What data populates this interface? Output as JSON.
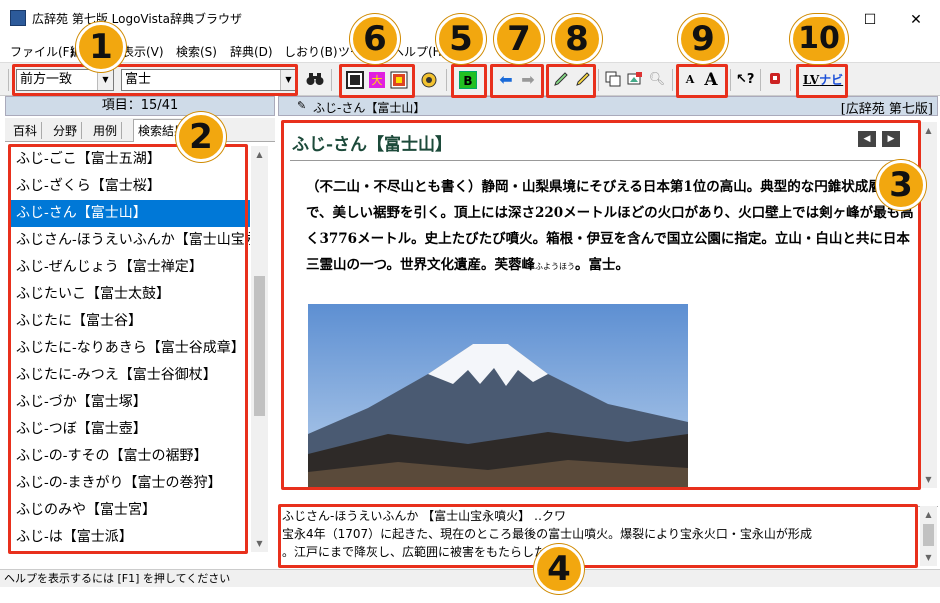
{
  "window": {
    "title": "広辞苑 第七版 LogoVista辞典ブラウザ",
    "minimize": "—",
    "maximize": "☐",
    "close": "✕"
  },
  "menu": [
    {
      "label": "ファイル(F)"
    },
    {
      "label": "編集(E)"
    },
    {
      "label": "表示(V)"
    },
    {
      "label": "検索(S)"
    },
    {
      "label": "辞典(D)"
    },
    {
      "label": "しおり(B)"
    },
    {
      "label": "ツール(T)"
    },
    {
      "label": "ヘルプ(H)"
    }
  ],
  "toolbar": {
    "search_mode": "前方一致",
    "query": "富士",
    "search_icon": "binoculars-icon",
    "highlight_b": "B",
    "font_small": "A",
    "font_large": "A",
    "lv_nav": "ナビ",
    "lv_prefix": "LV"
  },
  "left": {
    "count_label": "項目：15/41",
    "tabs": [
      "百科",
      "分野",
      "用例",
      "検索結果"
    ],
    "items": [
      "ふじ‐ごこ【富士五湖】",
      "ふじ‐ざくら【富士桜】",
      "ふじ‐さん【富士山】",
      "ふじさん‐ほうえいふんか【富士山宝永噴火】",
      "ふじ‐ぜんじょう【富士禅定】",
      "ふじたいこ【富士太鼓】",
      "ふじたに【富士谷】",
      "ふじたに‐なりあきら【富士谷成章】",
      "ふじたに‐みつえ【富士谷御杖】",
      "ふじ‐づか【富士塚】",
      "ふじ‐つぼ【富士壺】",
      "ふじ‐の‐すその【富士の裾野】",
      "ふじ‐の‐まきがり【富士の巻狩】",
      "ふじのみや【富士宮】",
      "ふじ‐は【富士派】"
    ],
    "selected_index": 2
  },
  "path_bar": {
    "entry": "ふじ-さん【富士山】",
    "dictionary": "[広辞苑 第七版]"
  },
  "entry": {
    "headword": "ふじ‐さん【富士山】",
    "definition": "（不二山・不尽山とも書く）静岡・山梨県境にそびえる日本第1位の高山。典型的な円錐状成層火山で、美しい裾野を引く。頂上には深さ220メートルほどの火口があり、火口壁上では剣ヶ峰が最も高く3776メートル。史上たびたび噴火。箱根・伊豆を含んで国立公園に指定。立山・白山と共に日本三霊山の一つ。世界文化遺産。芙蓉峰",
    "ruby": "ふようほう",
    "definition_tail": "。富士。",
    "prev": "◀",
    "next": "▶"
  },
  "sub_pane": {
    "line1": "ふじさん-ほうえいふんか 【富士山宝永噴火】 ‥クワ",
    "line2": "宝永4年（1707）に起きた、現在のところ最後の富士山噴火。爆裂により宝永火口・宝永山が形成",
    "line3": "。江戸にまで降灰し、広範囲に被害をもたらした。"
  },
  "status": "ヘルプを表示するには [F1] を押してください",
  "badges": [
    "1",
    "2",
    "3",
    "4",
    "5",
    "6",
    "7",
    "8",
    "9",
    "10"
  ],
  "colors": {
    "accent_red": "#e8301c",
    "badge": "#f2a70f",
    "selection": "#0078d7",
    "headword": "#1c4a3a"
  }
}
